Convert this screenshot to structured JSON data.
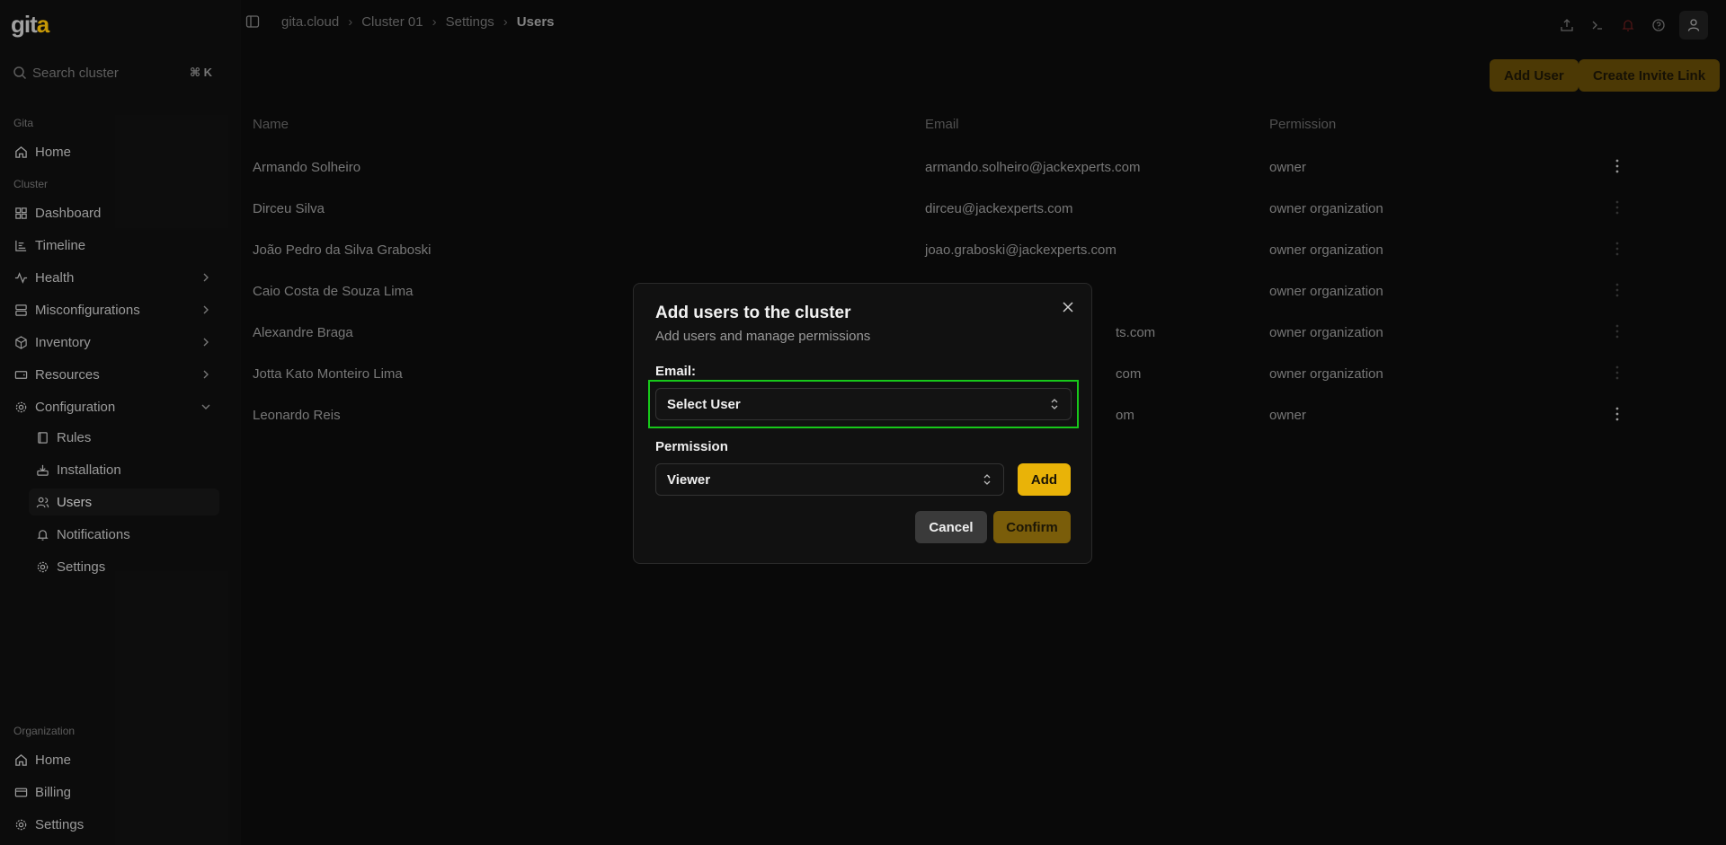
{
  "app": {
    "logo": "git",
    "logo_dot": "a"
  },
  "search": {
    "placeholder": "Search cluster",
    "shortcut": "⌘ K"
  },
  "sidebar": {
    "gita_title": "Gita",
    "gita_items": [
      {
        "label": "Home",
        "icon": "home-icon"
      }
    ],
    "cluster_title": "Cluster",
    "cluster_items": [
      {
        "label": "Dashboard",
        "icon": "dashboard-icon"
      },
      {
        "label": "Timeline",
        "icon": "timeline-icon"
      },
      {
        "label": "Health",
        "icon": "activity-icon"
      },
      {
        "label": "Misconfigurations",
        "icon": "server-icon"
      },
      {
        "label": "Inventory",
        "icon": "box-icon"
      },
      {
        "label": "Resources",
        "icon": "hard-drive-icon"
      },
      {
        "label": "Configuration",
        "icon": "gear-icon"
      }
    ],
    "config_sub": [
      {
        "label": "Rules",
        "icon": "book-icon"
      },
      {
        "label": "Installation",
        "icon": "install-icon"
      },
      {
        "label": "Users",
        "icon": "users-icon"
      },
      {
        "label": "Notifications",
        "icon": "bell-icon"
      },
      {
        "label": "Settings",
        "icon": "gear-icon"
      }
    ],
    "org_title": "Organization",
    "org_items": [
      {
        "label": "Home",
        "icon": "home-icon"
      },
      {
        "label": "Billing",
        "icon": "credit-card-icon"
      },
      {
        "label": "Settings",
        "icon": "gear-icon"
      }
    ]
  },
  "breadcrumb": [
    "gita.cloud",
    "Cluster 01",
    "Settings",
    "Users"
  ],
  "actions": {
    "add_user": "Add User",
    "create_invite": "Create Invite Link"
  },
  "table": {
    "headers": [
      "Name",
      "Email",
      "Permission"
    ],
    "rows": [
      {
        "name": "Armando Solheiro",
        "email": "armando.solheiro@jackexperts.com",
        "permission": "owner"
      },
      {
        "name": "Dirceu Silva",
        "email": "dirceu@jackexperts.com",
        "permission": "owner organization"
      },
      {
        "name": "João Pedro da Silva Graboski",
        "email": "joao.graboski@jackexperts.com",
        "permission": "owner organization"
      },
      {
        "name": "Caio Costa de Souza Lima",
        "email": "",
        "permission": "owner organization"
      },
      {
        "name": "Alexandre Braga",
        "email": "ts.com",
        "permission": "owner organization"
      },
      {
        "name": "Jotta Kato Monteiro Lima",
        "email": "com",
        "permission": "owner organization"
      },
      {
        "name": "Leonardo Reis",
        "email": "om",
        "permission": "owner"
      }
    ]
  },
  "modal": {
    "title": "Add users to the cluster",
    "subtitle": "Add users and manage permissions",
    "email_label": "Email:",
    "email_select": "Select User",
    "permission_label": "Permission",
    "permission_select": "Viewer",
    "add": "Add",
    "cancel": "Cancel",
    "confirm": "Confirm"
  },
  "colors": {
    "accent": "#e9b308",
    "highlight": "#17c81a"
  }
}
